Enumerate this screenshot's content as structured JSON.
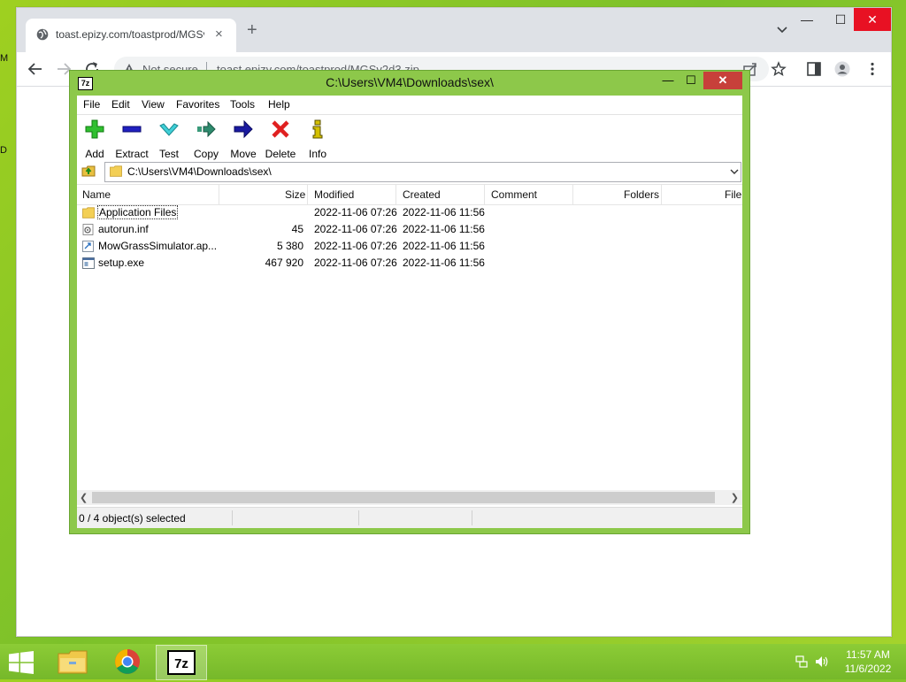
{
  "desktop": {
    "edge_chars": [
      "M",
      "D"
    ]
  },
  "browser": {
    "tab_title": "toast.epizy.com/toastprod/MGSv",
    "tab_close": "×",
    "new_tab": "+",
    "window_controls": {
      "minimize": "—",
      "maximize": "☐",
      "close": "✕"
    },
    "security_label": "Not secure",
    "url": "toast.epizy.com/toastprod/MGSv2d3.zip"
  },
  "sevenzip": {
    "title": "C:\\Users\\VM4\\Downloads\\sex\\",
    "window_controls": {
      "minimize": "—",
      "maximize": "☐",
      "close": "✕"
    },
    "menu": [
      "File",
      "Edit",
      "View",
      "Favorites",
      "Tools",
      "Help"
    ],
    "toolbar": {
      "add": "Add",
      "extract": "Extract",
      "test": "Test",
      "copy": "Copy",
      "move": "Move",
      "delete": "Delete",
      "info": "Info"
    },
    "address": "C:\\Users\\VM4\\Downloads\\sex\\",
    "columns": {
      "name": "Name",
      "size": "Size",
      "modified": "Modified",
      "created": "Created",
      "comment": "Comment",
      "folders": "Folders",
      "files": "File"
    },
    "rows": [
      {
        "name": "Application Files",
        "size": "",
        "modified": "2022-11-06 07:26",
        "created": "2022-11-06 11:56",
        "icon": "folder-icon"
      },
      {
        "name": "autorun.inf",
        "size": "45",
        "modified": "2022-11-06 07:26",
        "created": "2022-11-06 11:56",
        "icon": "settings-file-icon"
      },
      {
        "name": "MowGrassSimulator.ap...",
        "size": "5 380",
        "modified": "2022-11-06 07:26",
        "created": "2022-11-06 11:56",
        "icon": "application-manifest-icon"
      },
      {
        "name": "setup.exe",
        "size": "467 920",
        "modified": "2022-11-06 07:26",
        "created": "2022-11-06 11:56",
        "icon": "executable-icon"
      }
    ],
    "status": "0 / 4 object(s) selected",
    "scroll_left": "❮",
    "scroll_right": "❯"
  },
  "taskbar": {
    "time": "11:57 AM",
    "date": "11/6/2022"
  },
  "colors": {
    "desktop_green": "#8dc84a",
    "close_red": "#c7403a",
    "chrome_tabstrip": "#dee1e6"
  }
}
